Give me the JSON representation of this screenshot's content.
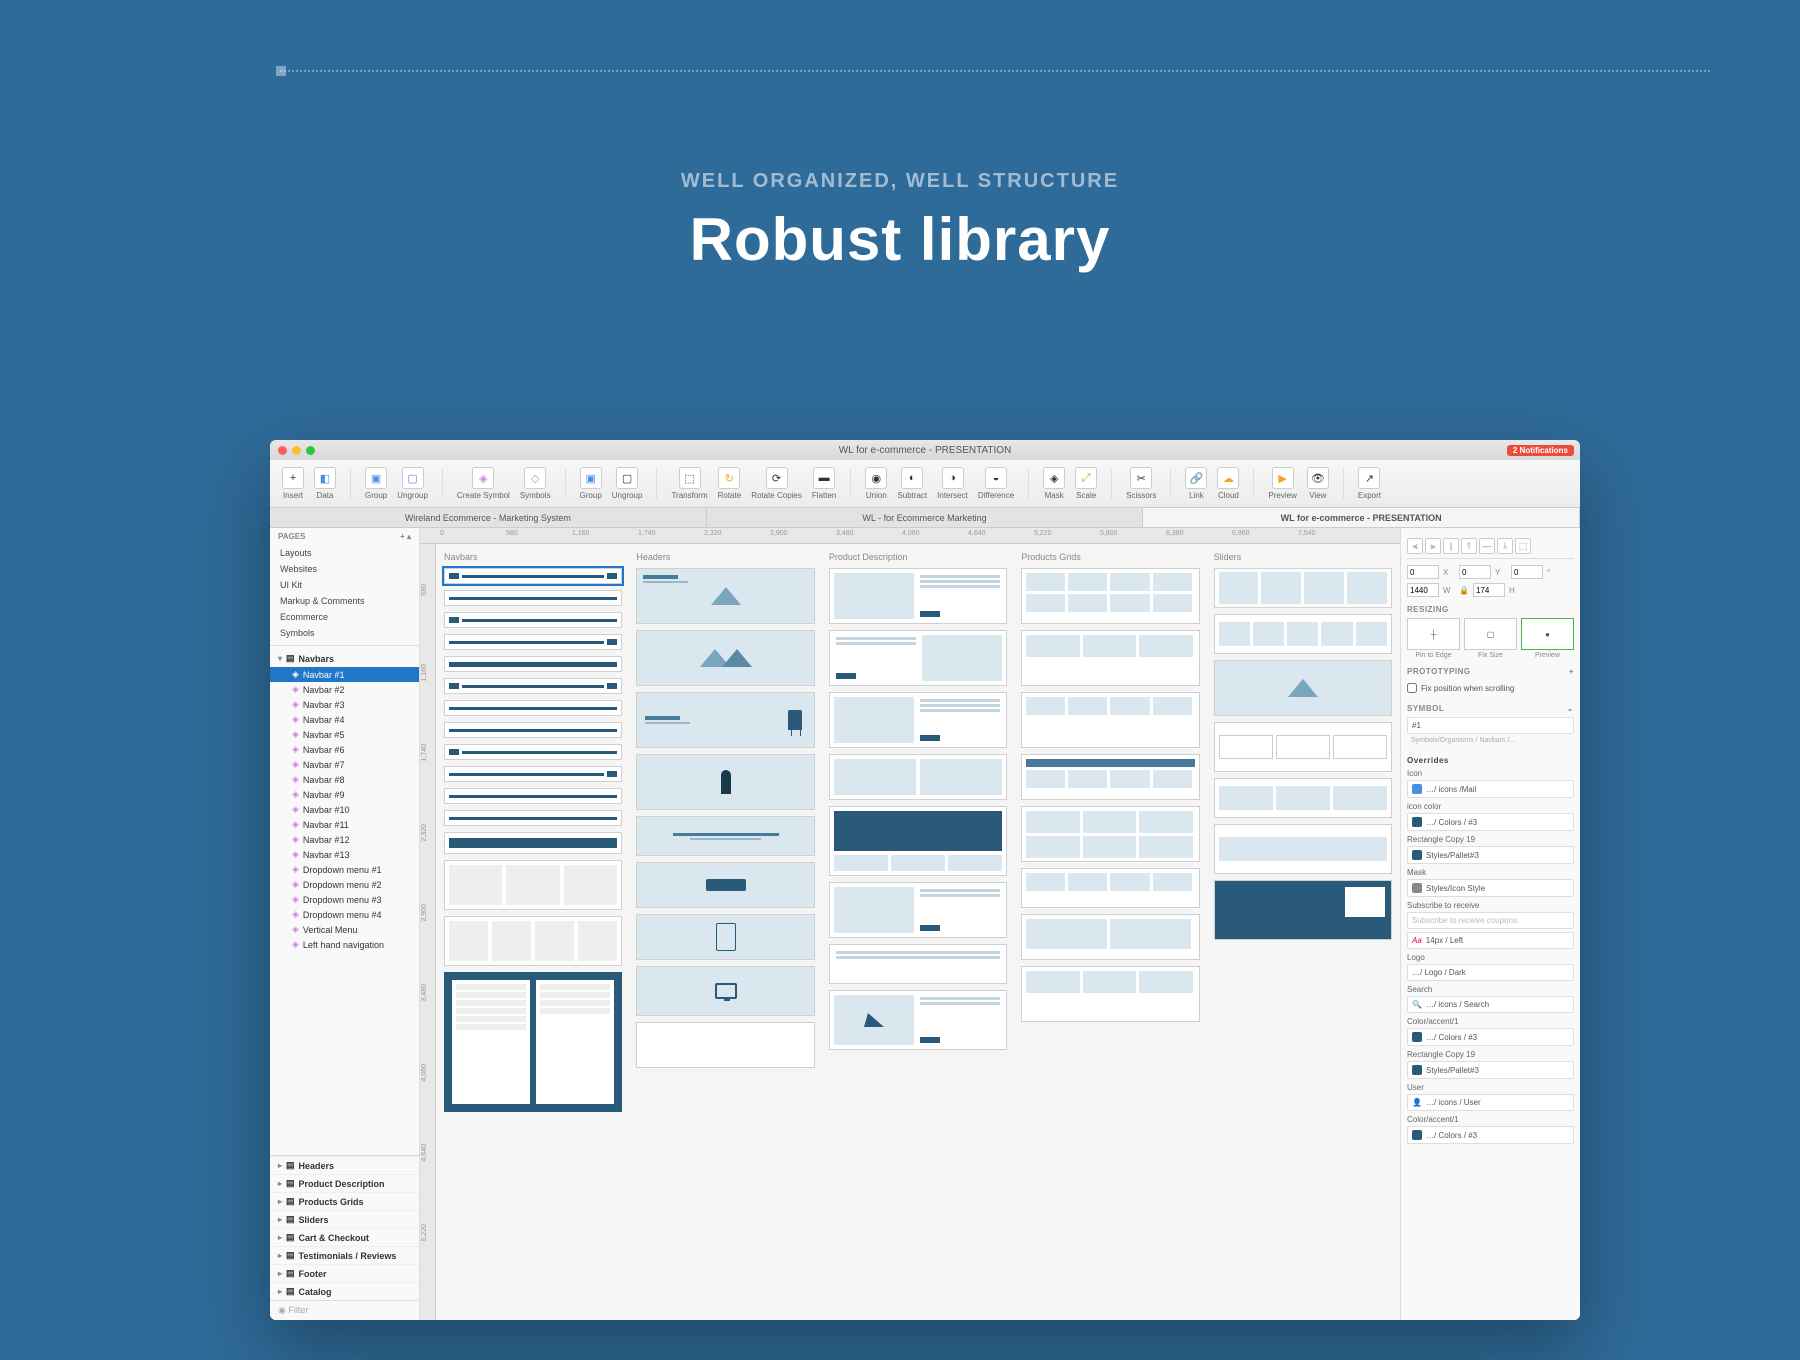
{
  "hero": {
    "subtitle": "WELL ORGANIZED, WELL STRUCTURE",
    "title": "Robust library"
  },
  "window": {
    "title": "WL for e-commerce - PRESENTATION",
    "notifications": "2 Notifications"
  },
  "toolbar": {
    "insert": "Insert",
    "data": "Data",
    "group": "Group",
    "ungroup": "Ungroup",
    "create_symbol": "Create Symbol",
    "symbols": "Symbols",
    "group2": "Group",
    "ungroup2": "Ungroup",
    "transform": "Transform",
    "rotate": "Rotate",
    "rotate_copies": "Rotate Copies",
    "flatten": "Flatten",
    "union": "Union",
    "subtract": "Subtract",
    "intersect": "Intersect",
    "difference": "Difference",
    "mask": "Mask",
    "scale": "Scale",
    "scissors": "Scissors",
    "link": "Link",
    "cloud": "Cloud",
    "preview": "Preview",
    "view": "View",
    "export": "Export"
  },
  "tabs": [
    "Wireland Ecommerce - Marketing System",
    "WL - for Ecommerce Marketing",
    "WL for e-commerce - PRESENTATION"
  ],
  "ruler_h": [
    "0",
    "580",
    "1,160",
    "1,740",
    "2,320",
    "2,900",
    "3,480",
    "4,060",
    "4,640",
    "5,220",
    "5,800",
    "6,380",
    "6,960",
    "7,540"
  ],
  "ruler_v": [
    "580",
    "1,160",
    "1,740",
    "2,320",
    "2,900",
    "3,480",
    "4,060",
    "4,640",
    "5,220"
  ],
  "sidebar": {
    "pages_label": "PAGES",
    "pages": [
      "Layouts",
      "Websites",
      "UI Kit",
      "Markup & Comments",
      "Ecommerce",
      "Symbols"
    ],
    "layers": {
      "navbars": "Navbars",
      "items": [
        "Navbar #1",
        "Navbar #2",
        "Navbar #3",
        "Navbar #4",
        "Navbar #5",
        "Navbar #6",
        "Navbar #7",
        "Navbar #8",
        "Navbar #9",
        "Navbar #10",
        "Navbar #11",
        "Navbar #12",
        "Navbar #13",
        "Dropdown menu #1",
        "Dropdown menu #2",
        "Dropdown menu #3",
        "Dropdown menu #4",
        "Vertical Menu",
        "Left hand navigation"
      ],
      "groups": [
        "Headers",
        "Product Description",
        "Products Grids",
        "Sliders",
        "Cart & Checkout",
        "Testimonials / Reviews",
        "Footer",
        "Catalog"
      ]
    },
    "filter": "Filter"
  },
  "canvas": {
    "columns": [
      "Navbars",
      "Headers",
      "Product Description",
      "Products Grids",
      "Sliders"
    ]
  },
  "inspector": {
    "x": "0",
    "y": "0",
    "w": "1440",
    "h": "174",
    "angle": "0",
    "resizing": "RESIZING",
    "resize_labels": [
      "Pin to Edge",
      "Fix Size",
      "Preview"
    ],
    "prototyping": "PROTOTYPING",
    "fix_scroll": "Fix position when scrolling",
    "symbol": "SYMBOL",
    "symbol_name": "#1",
    "symbol_path": "Symbols/Organisms / Navbars /…",
    "overrides": "Overrides",
    "icon_label": "Icon",
    "icon_val": "…/ icons /Mail",
    "icon_color_label": "icon color",
    "icon_color_val": "…/ Colors / #3",
    "rect_label": "Rectangle Copy 19",
    "rect_val": "Styles/Pallet#3",
    "mask_label": "Mask",
    "mask_val": "Styles/Icon Style",
    "subscribe_label": "Subscribe to receive",
    "subscribe_ph": "Subscribe to receive coupons",
    "font_val": "14px / Left",
    "logo_label": "Logo",
    "logo_val": "…/ Logo / Dark",
    "search_label": "Search",
    "search_val": "…/ icons / Search",
    "color_accent_label": "Color/accent/1",
    "color_accent_val": "…/ Colors / #3",
    "rect2_label": "Rectangle Copy 19",
    "rect2_val": "Styles/Pallet#3",
    "user_label": "User",
    "user_val": "…/ icons / User",
    "color_accent2_label": "Color/accent/1",
    "color_accent2_val": "…/ Colors / #3"
  }
}
